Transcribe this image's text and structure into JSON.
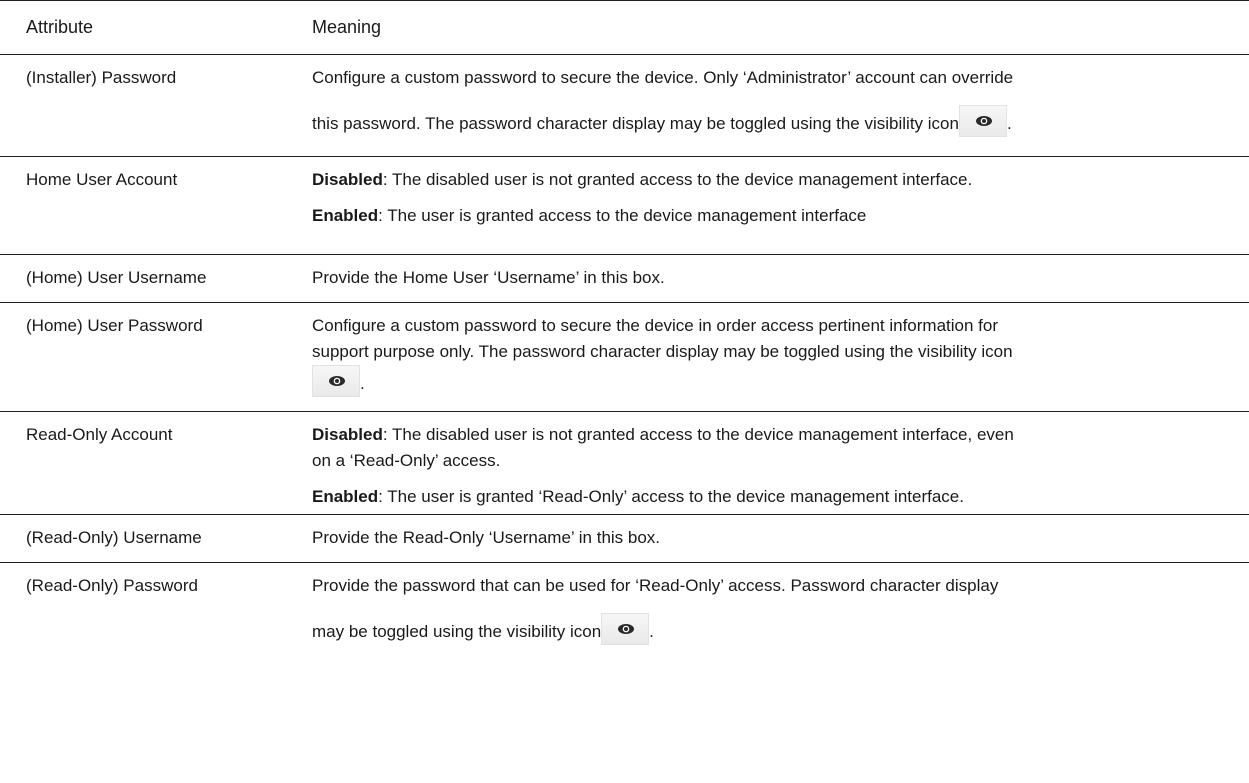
{
  "table": {
    "header": {
      "attribute": "Attribute",
      "meaning": "Meaning"
    },
    "rows": [
      {
        "attribute": "(Installer) Password",
        "line1": "Configure a custom password to secure the device. Only ‘Administrator’ account can override",
        "line2_text": "this password. The password character display may be toggled using the visibility icon",
        "line2_suffix": "."
      },
      {
        "attribute": "Home User Account",
        "p1_bold": "Disabled",
        "p1_text": ": The disabled user is not granted access to the device management interface.",
        "p2_bold": "Enabled",
        "p2_text": ": The user is granted access to the device management interface"
      },
      {
        "attribute": "(Home) User Username",
        "text": "Provide the Home User ‘Username’ in this box."
      },
      {
        "attribute": "(Home) User Password",
        "line1": "Configure a custom password to secure the device in order access pertinent information for",
        "line2": "support purpose only. The password character display may be toggled using the visibility icon",
        "line3_suffix": "."
      },
      {
        "attribute": "Read-Only Account",
        "p1_bold": "Disabled",
        "p1_line1": ": The disabled user is not granted access to the device management interface, even",
        "p1_line2": "on a ‘Read-Only’ access.",
        "p2_bold": "Enabled",
        "p2_text": ": The user is granted ‘Read-Only’ access to the device management interface."
      },
      {
        "attribute": "(Read-Only) Username",
        "text": "Provide the Read-Only ‘Username’ in this box."
      },
      {
        "attribute": "(Read-Only) Password",
        "line1": "Provide the password that can be used for ‘Read-Only’ access. Password character display",
        "line2_text": "may be toggled using the visibility icon",
        "line2_suffix": "."
      }
    ]
  },
  "icons": {
    "visibility": "eye-icon"
  }
}
